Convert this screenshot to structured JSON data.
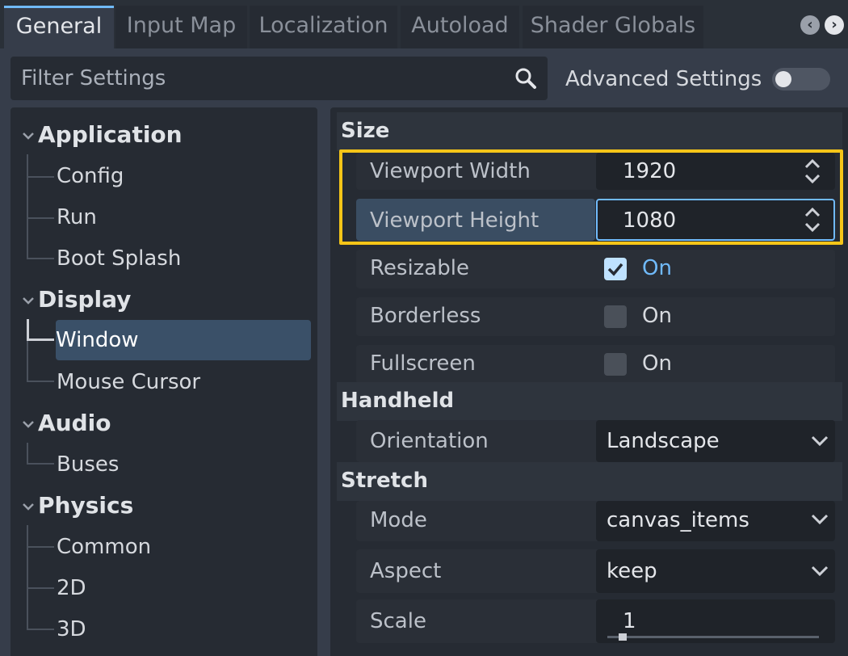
{
  "tabs": [
    "General",
    "Input Map",
    "Localization",
    "Autoload",
    "Shader Globals"
  ],
  "filter": {
    "placeholder": "Filter Settings"
  },
  "advanced": {
    "label": "Advanced Settings",
    "enabled": false
  },
  "tree": {
    "categories": [
      {
        "name": "Application",
        "items": [
          "Config",
          "Run",
          "Boot Splash"
        ]
      },
      {
        "name": "Display",
        "items": [
          "Window",
          "Mouse Cursor"
        ]
      },
      {
        "name": "Audio",
        "items": [
          "Buses"
        ]
      },
      {
        "name": "Physics",
        "items": [
          "Common",
          "2D",
          "3D"
        ]
      }
    ],
    "selected": "Window"
  },
  "inspector": {
    "groups": [
      "Size",
      "Handheld",
      "Stretch"
    ],
    "size": {
      "viewport_width": {
        "label": "Viewport Width",
        "value": "1920"
      },
      "viewport_height": {
        "label": "Viewport Height",
        "value": "1080"
      },
      "resizable": {
        "label": "Resizable",
        "value": "On",
        "checked": true
      },
      "borderless": {
        "label": "Borderless",
        "value": "On",
        "checked": false
      },
      "fullscreen": {
        "label": "Fullscreen",
        "value": "On",
        "checked": false
      }
    },
    "handheld": {
      "orientation": {
        "label": "Orientation",
        "value": "Landscape"
      }
    },
    "stretch": {
      "mode": {
        "label": "Mode",
        "value": "canvas_items"
      },
      "aspect": {
        "label": "Aspect",
        "value": "keep"
      },
      "scale": {
        "label": "Scale",
        "value": "1"
      }
    }
  },
  "colors": {
    "accent": "#70bafa",
    "highlight": "#f5c518",
    "selected_bg": "#3a5068"
  }
}
